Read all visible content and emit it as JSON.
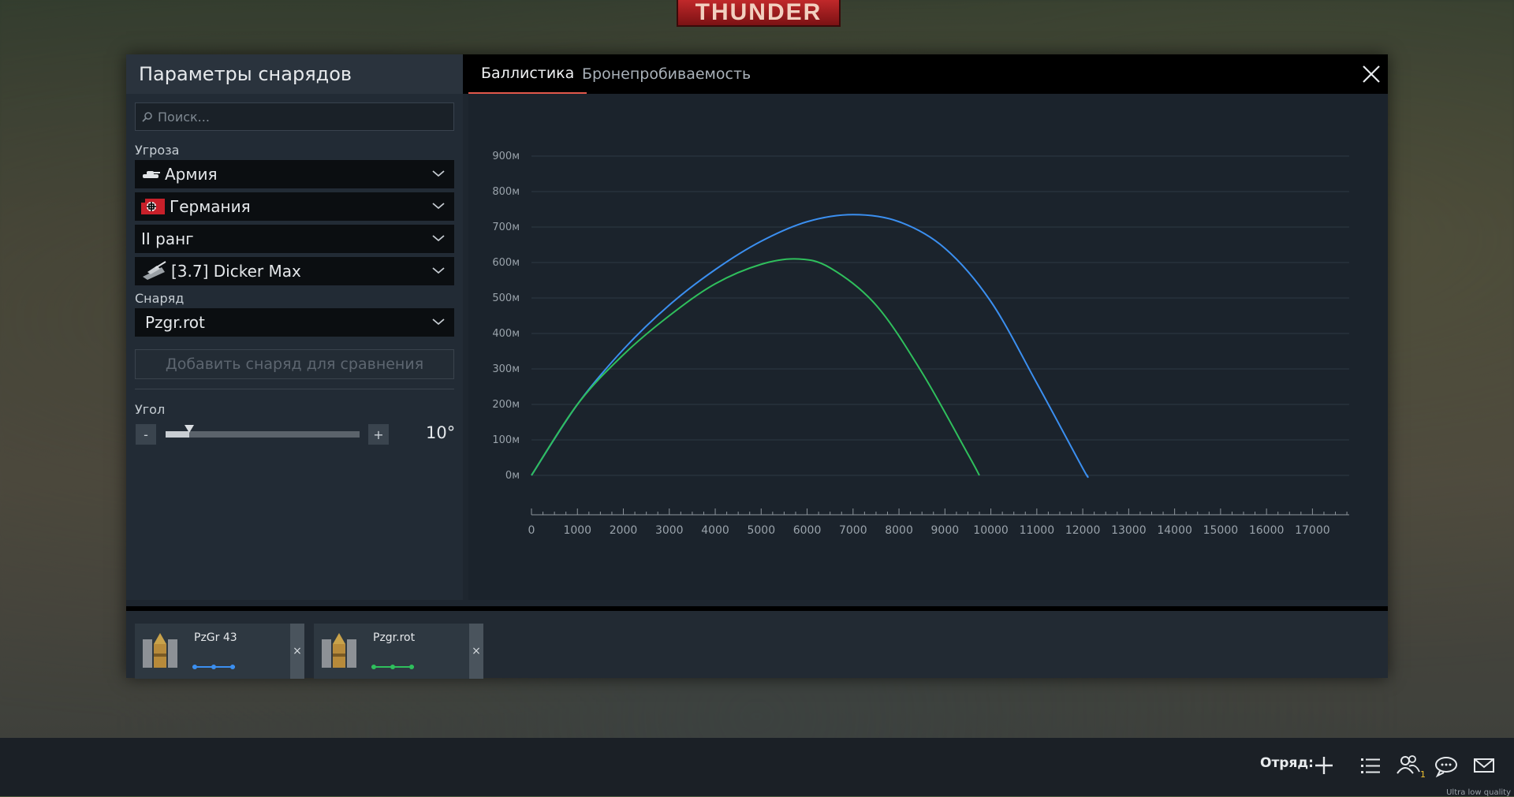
{
  "logo": {
    "text": "THUNDER"
  },
  "panel": {
    "title": "Параметры снарядов",
    "search_placeholder": "Поиск...",
    "threat_label": "Угроза",
    "dropdowns": [
      {
        "value": "Армия",
        "icon": "tank-silhouette-icon"
      },
      {
        "value": "Германия",
        "icon": "germany-flag-icon"
      },
      {
        "value": "II ранг",
        "icon": ""
      },
      {
        "value": "[3.7] Dicker Max",
        "icon": "vehicle-icon"
      }
    ],
    "shell_label": "Снаряд",
    "shell_value": "Pzgr.rot",
    "add_button": "Добавить снаряд для сравнения",
    "angle_label": "Угол",
    "minus": "-",
    "plus": "+",
    "angle_value": "10°",
    "angle_slider_fraction": 0.12
  },
  "tabs": [
    {
      "label": "Баллистика",
      "active": true
    },
    {
      "label": "Бронепробиваемость",
      "active": false
    }
  ],
  "chart_data": {
    "type": "line",
    "y_ticks": [
      "900м",
      "800м",
      "700м",
      "600м",
      "500м",
      "400м",
      "300м",
      "200м",
      "100м",
      "0м"
    ],
    "x_ticks": [
      "0",
      "1000",
      "2000",
      "3000",
      "4000",
      "5000",
      "6000",
      "7000",
      "8000",
      "9000",
      "10000",
      "11000",
      "12000",
      "13000",
      "14000",
      "15000",
      "16000",
      "17000"
    ],
    "xlim": [
      0,
      17800
    ],
    "ylim": [
      0,
      900
    ],
    "grid": true,
    "series": [
      {
        "color": "#3b8ff0",
        "x": [
          0,
          1000,
          2000,
          3000,
          4000,
          5000,
          6000,
          7000,
          8000,
          9000,
          10000,
          11000,
          12000,
          12100
        ],
        "y": [
          0,
          200,
          355,
          480,
          580,
          660,
          715,
          735,
          715,
          640,
          490,
          260,
          20,
          0
        ]
      },
      {
        "color": "#2fbf5c",
        "x": [
          0,
          1000,
          2000,
          3000,
          4000,
          5000,
          5800,
          6500,
          7500,
          8500,
          9500,
          9750
        ],
        "y": [
          0,
          200,
          340,
          450,
          540,
          595,
          610,
          585,
          480,
          290,
          60,
          0
        ]
      }
    ]
  },
  "shells": [
    {
      "name": "PzGr 43",
      "color": "#3b8ff0",
      "close": "×"
    },
    {
      "name": "Pzgr.rot",
      "color": "#2fbf5c",
      "close": "×"
    }
  ],
  "taskbar": {
    "squad_label": "Отряд:",
    "friends_badge": "1",
    "quality": "Ultra low quality"
  }
}
